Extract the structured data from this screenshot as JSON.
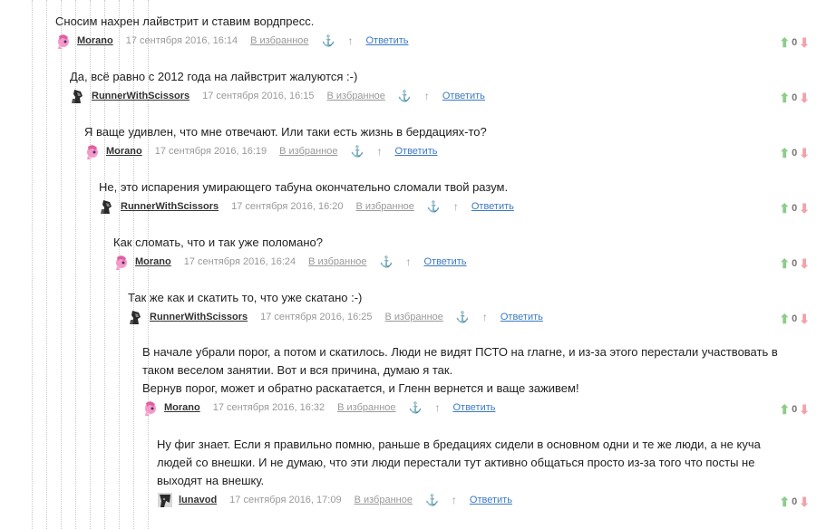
{
  "labels": {
    "fav": "В избранное",
    "anchor": "⚓",
    "parent": "↑",
    "reply": "Ответить",
    "up": "⬆",
    "down": "⬇"
  },
  "comments": [
    {
      "text": "Сносим нахрен лайвстрит и ставим вордпресс.",
      "author": "Morano",
      "avatar": "pony-avatar",
      "date": "17 сентября 2016, 16:14",
      "score": "0"
    },
    {
      "text": "Да, всё равно с 2012 года на лайвстрит жалуются :-)",
      "author": "RunnerWithScissors",
      "avatar": "dark-pony-avatar",
      "date": "17 сентября 2016, 16:15",
      "score": "0"
    },
    {
      "text": "Я ваще удивлен, что мне отвечают. Или таки есть жизнь в бердациях-то?",
      "author": "Morano",
      "avatar": "pony-avatar",
      "date": "17 сентября 2016, 16:19",
      "score": "0"
    },
    {
      "text": "Не, это испарения умирающего табуна окончательно сломали твой разум.",
      "author": "RunnerWithScissors",
      "avatar": "dark-pony-avatar",
      "date": "17 сентября 2016, 16:20",
      "score": "0"
    },
    {
      "text": "Как сломать, что и так уже поломано?",
      "author": "Morano",
      "avatar": "pony-avatar",
      "date": "17 сентября 2016, 16:24",
      "score": "0"
    },
    {
      "text": "Так же как и скатить то, что уже скатано :-)",
      "author": "RunnerWithScissors",
      "avatar": "dark-pony-avatar",
      "date": "17 сентября 2016, 16:25",
      "score": "0"
    },
    {
      "text": "В начале убрали порог, а потом и скатилось. Люди не видят ПСТО на глагне, и из-за этого перестали участвовать в таком веселом занятии. Вот и вся причина, думаю я так.\nВернув порог, может и обратно раскатается, и Гленн вернется и ваще заживем!",
      "author": "Morano",
      "avatar": "pony-avatar",
      "date": "17 сентября 2016, 16:32",
      "score": "0"
    },
    {
      "text": "Ну фиг знает. Если я правильно помню, раньше в бредациях сидели в основном одни и те же люди, а не куча людей со внешки. И не думаю, что эти люди перестали тут активно общаться просто из-за того что посты не выходят на внешку.",
      "author": "lunavod",
      "avatar": "dark-avatar",
      "date": "17 сентября 2016, 17:09",
      "score": "0"
    }
  ],
  "colors": {
    "pony": "#f59ac8",
    "dark": "#2a2a2a",
    "up": "#8dcc8a",
    "down": "#f0a3a9",
    "link": "#3a79c4"
  }
}
